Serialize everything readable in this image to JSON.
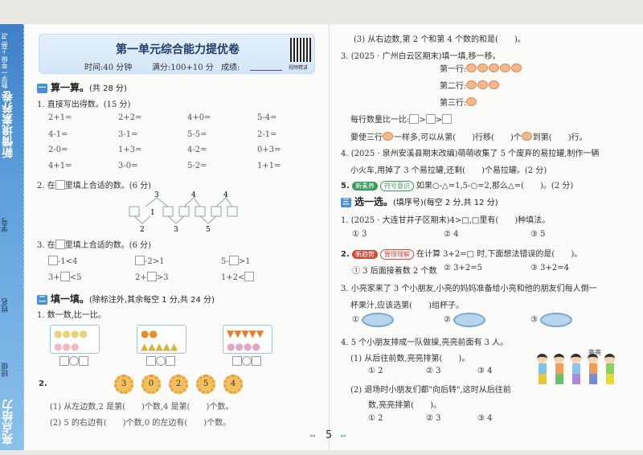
{
  "sidebar": {
    "series": "新情境素养卷",
    "grade": "数学一年级 上册 RJ",
    "student_no": "学号",
    "name": "姓名",
    "class": "班级",
    "brand": "亮点给力"
  },
  "header": {
    "title": "第一单元综合能力提优卷",
    "time": "时间:40 分钟",
    "full": "满分:100+10 分",
    "score": "成绩:",
    "qr_caption": "视频精讲"
  },
  "left": {
    "s1": {
      "num": "一",
      "title": "算一算。",
      "pts": "(共 28 分)"
    },
    "q1": {
      "title": "1. 直接写出得数。(15 分)",
      "items": [
        "2+1=",
        "2+2=",
        "4+0=",
        "5-4=",
        "4-1=",
        "3-1=",
        "5-5=",
        "2-1=",
        "2-0=",
        "1+3=",
        "4-2=",
        "0+3=",
        "4+1=",
        "3-0=",
        "5-2=",
        "1+1="
      ]
    },
    "q2": {
      "pre": "2. 在",
      "post": "里填上合适的数。(6 分)",
      "top": [
        "3",
        "4",
        "4"
      ],
      "mid": "1",
      "bottom": [
        "2",
        "3",
        "5"
      ]
    },
    "q3": {
      "pre": "3. 在",
      "post": "里填上合适的数。(6 分)",
      "items": [
        [
          "",
          "-1<4"
        ],
        [
          "",
          "-2>1"
        ],
        [
          "5-",
          ">1"
        ],
        [
          "3+",
          "<5"
        ],
        [
          "2+",
          ">3"
        ],
        [
          "1+2<",
          ""
        ]
      ]
    },
    "s2": {
      "num": "二",
      "title": "填一填。",
      "pts": "(除标注外,其余每空 1 分,共 24 分)"
    },
    "f1": {
      "title": "1. 数一数,比一比。"
    },
    "f2": {
      "num": "2.",
      "flowers": [
        "3",
        "0",
        "2",
        "5",
        "4"
      ],
      "p1": "(1) 从左边数,2 是第(　　)个数,4 是第(　　)个数。",
      "p2": "(2) 5 的右边有(　　)个数,0 的左边有(　　)个数。"
    }
  },
  "right": {
    "p3": "(3) 从右边数,第 2 个和第 4 个数的和是(　　)。",
    "q3": {
      "title": "3. (2025 · 广州白云区期末)填一填,移一移。",
      "rows": [
        {
          "label": "第一行:",
          "count": 5
        },
        {
          "label": "第二行:",
          "count": 3
        },
        {
          "label": "第三行:",
          "count": 1
        }
      ],
      "compare": "每行数量比一比:",
      "move_a": "要使三行",
      "move_b": "一样多,可以从第(　　)行移(　　)个",
      "move_c": "到第(　　)行。"
    },
    "q4": {
      "l1": "4. (2025 · 泉州安溪县期末改编)萌萌收集了 5 个废弃的易拉罐,制作一辆",
      "l2": "小火车,用掉了 3 个易拉罐,还剩(　　)个易拉罐。(2 分)"
    },
    "q5": {
      "num": "5.",
      "tag1": "新素养",
      "tag2": "符号意识",
      "text": "如果○-△=1,5-○=2,那么△=(　　)。(2 分)"
    },
    "s3": {
      "num": "三",
      "title": "选一选。",
      "pts": "(填序号)(每空 2 分,共 12 分)"
    },
    "c1": {
      "title": "1. (2025 · 大连甘井子区期末)4>□,□里有(　　)种填法。",
      "opts": [
        "① 3",
        "② 4",
        "③ 5"
      ]
    },
    "c2": {
      "num": "2.",
      "tag1": "新趋势",
      "tag2": "算理理解",
      "text": "在计算 3+2=□ 时,下面想法错误的是(　　)。",
      "opts": [
        "① 3 后面接着数 2 个数",
        "② 3+2=5",
        "③ 3+2=4"
      ]
    },
    "c3": {
      "l1": "3. 小亮家来了 3 个小朋友,小亮的妈妈准备给小亮和他的朋友们每人倒一",
      "l2": "杯果汁,应该选第(　　)组杯子。",
      "opts": [
        "①",
        "②",
        "③"
      ]
    },
    "c4": {
      "title": "4. 5 个小朋友排成一队做操,亮亮前面有 3 人。",
      "p1": "(1) 从后往前数,亮亮排第(　　)。",
      "o1": [
        "① 2",
        "② 3",
        "③ 4"
      ],
      "p2a": "(2) 退场时小朋友们都\"向后转\",这时从后往前",
      "p2b": "数,亮亮排第(　　)。",
      "o2": [
        "① 2",
        "② 3",
        "③ 4"
      ],
      "kid_label": "亮亮"
    }
  },
  "footer": {
    "page": "5"
  }
}
